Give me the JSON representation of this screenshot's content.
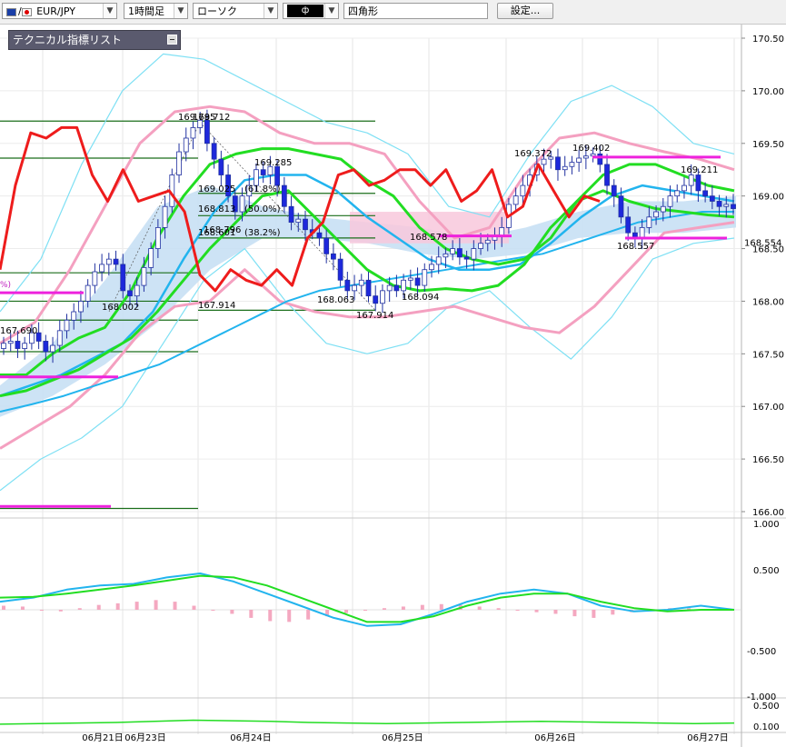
{
  "toolbar": {
    "symbol": "EUR/JPY",
    "timeframe": "1時間足",
    "chart_style": "ローソク",
    "draw_mode": "ф",
    "shape": "四角形",
    "settings_label": "設定..."
  },
  "indicator_panel": {
    "title": "テクニカル指標リスト"
  },
  "colors": {
    "up_candle": "#ffffff",
    "down_candle": "#1e28dc",
    "rsi_line": "#ee1c1c",
    "ma_green": "#22dd22",
    "ma_blue": "#22b4ee",
    "bollinger_pink": "#f4a0c0",
    "bollinger_outer": "#7ee0f4",
    "cloud": "#c8e0f4",
    "fib_line": "#1a6e1a",
    "magenta_line": "#ee22dd"
  },
  "chart_data": [
    {
      "type": "candlestick",
      "title": "",
      "yaxis_ticks": [
        "170.50",
        "170.00",
        "169.50",
        "169.00",
        "168.50",
        "168.00",
        "167.50",
        "167.00",
        "166.50",
        "166.00"
      ],
      "ylim": [
        165.95,
        170.55
      ],
      "current_price_label": "168.554",
      "xaxis_ticks": [
        "06月21日",
        "06月23日",
        "06月24日",
        "06月25日",
        "06月26日",
        "06月27日"
      ],
      "price_labels": [
        "167.690",
        "168.002",
        "169.712",
        "169.785",
        "169.285",
        "168.796",
        "168.063",
        "167.914",
        "167.914",
        "168.094",
        "168.578",
        "169.372",
        "169.402",
        "169.211",
        "168.557"
      ],
      "fib_labels": [
        "169.025",
        "(61.8%)",
        "168.813",
        "(50.0%)",
        "168.601",
        "(38.2%)"
      ],
      "partial_label": "%)",
      "close": [
        167.6,
        167.62,
        167.55,
        167.6,
        167.7,
        167.62,
        167.52,
        167.58,
        167.72,
        167.82,
        167.9,
        168.0,
        168.15,
        168.28,
        168.35,
        168.4,
        168.35,
        168.1,
        168.05,
        168.15,
        168.32,
        168.5,
        168.7,
        168.9,
        169.2,
        169.42,
        169.55,
        169.65,
        169.72,
        169.5,
        169.35,
        169.2,
        169.0,
        168.85,
        169.0,
        169.1,
        169.25,
        169.2,
        169.28,
        169.1,
        168.9,
        168.75,
        168.78,
        168.68,
        168.65,
        168.6,
        168.45,
        168.4,
        168.2,
        168.1,
        168.15,
        168.2,
        168.05,
        167.98,
        168.1,
        168.15,
        168.1,
        168.2,
        168.22,
        168.15,
        168.3,
        168.35,
        168.42,
        168.45,
        168.5,
        168.42,
        168.4,
        168.5,
        168.55,
        168.58,
        168.62,
        168.7,
        168.92,
        169.0,
        169.1,
        169.2,
        169.3,
        169.35,
        169.37,
        169.25,
        169.28,
        169.32,
        169.36,
        169.38,
        169.4,
        169.3,
        169.1,
        169.0,
        168.8,
        168.65,
        168.6,
        168.7,
        168.8,
        168.85,
        168.9,
        169.0,
        169.05,
        169.1,
        169.2,
        169.05,
        169.0,
        168.95,
        168.9,
        168.92,
        168.88
      ],
      "fib_levels": [
        167.914,
        168.27,
        168.601,
        168.813,
        169.025,
        169.36,
        169.712
      ],
      "rsi_line": [
        168.3,
        169.1,
        169.6,
        169.55,
        169.65,
        169.65,
        169.2,
        168.95,
        169.25,
        168.95,
        169.0,
        169.05,
        168.85,
        168.25,
        168.1,
        168.3,
        168.2,
        168.15,
        168.3,
        168.15,
        168.6,
        168.75,
        169.2,
        169.25,
        169.1,
        169.15,
        169.25,
        169.25,
        169.1,
        169.25,
        168.95,
        169.05,
        169.25,
        168.8,
        168.9,
        169.3,
        169.05,
        168.8,
        169.0,
        168.95
      ],
      "ma_green_1": [
        167.3,
        167.3,
        167.5,
        167.65,
        167.75,
        168.1,
        168.6,
        169.0,
        169.3,
        169.4,
        169.45,
        169.45,
        169.4,
        169.35,
        169.15,
        169.0,
        168.7,
        168.5,
        168.4,
        168.35,
        168.4,
        168.6,
        168.95,
        169.2,
        169.3,
        169.3,
        169.2,
        169.1,
        169.05
      ],
      "ma_green_2": [
        167.1,
        167.15,
        167.25,
        167.35,
        167.5,
        167.65,
        167.9,
        168.2,
        168.5,
        168.75,
        169.0,
        169.05,
        168.8,
        168.55,
        168.3,
        168.15,
        168.1,
        168.12,
        168.1,
        168.15,
        168.35,
        168.7,
        168.95,
        169.05,
        168.95,
        168.88,
        168.85,
        168.82,
        168.8
      ],
      "ma_blue_1": [
        167.1,
        167.2,
        167.3,
        167.45,
        167.6,
        167.9,
        168.4,
        168.85,
        169.15,
        169.2,
        169.2,
        169.05,
        168.8,
        168.6,
        168.4,
        168.3,
        168.3,
        168.35,
        168.55,
        168.8,
        169.0,
        169.1,
        169.05,
        169.0,
        168.95
      ],
      "ma_blue_2": [
        166.95,
        167.02,
        167.1,
        167.2,
        167.3,
        167.4,
        167.55,
        167.7,
        167.85,
        168.0,
        168.1,
        168.15,
        168.2,
        168.25,
        168.3,
        168.35,
        168.4,
        168.45,
        168.55,
        168.65,
        168.75,
        168.8,
        168.85,
        168.85
      ],
      "bb_pink_upper": [
        167.6,
        167.8,
        168.3,
        168.9,
        169.5,
        169.8,
        169.85,
        169.8,
        169.6,
        169.5,
        169.5,
        169.4,
        168.95,
        168.6,
        168.7,
        169.2,
        169.55,
        169.6,
        169.5,
        169.42,
        169.35,
        169.25
      ],
      "bb_pink_lower": [
        166.6,
        166.8,
        167.0,
        167.3,
        167.7,
        167.95,
        168.0,
        168.3,
        168.0,
        167.9,
        167.85,
        167.85,
        167.9,
        167.95,
        167.85,
        167.75,
        167.7,
        167.95,
        168.3,
        168.65,
        168.7,
        168.75
      ],
      "bb_cyan_upper": [
        167.9,
        168.4,
        169.3,
        170.0,
        170.35,
        170.3,
        170.1,
        169.9,
        169.7,
        169.6,
        169.4,
        168.9,
        168.8,
        169.4,
        169.9,
        170.05,
        169.85,
        169.5,
        169.4
      ],
      "bb_cyan_lower": [
        166.2,
        166.5,
        166.7,
        167.0,
        167.6,
        168.2,
        168.5,
        168.0,
        167.6,
        167.5,
        167.6,
        167.95,
        168.1,
        167.75,
        167.45,
        167.85,
        168.4,
        168.55,
        168.6
      ],
      "cloud_top": [
        167.2,
        167.6,
        168.2,
        168.9,
        169.1,
        168.9,
        168.8,
        168.75,
        168.7,
        168.6,
        168.7,
        168.85,
        168.95,
        168.95,
        169.0
      ],
      "cloud_bottom": [
        166.9,
        167.1,
        167.4,
        167.8,
        168.3,
        168.6,
        168.6,
        168.55,
        168.45,
        168.4,
        168.45,
        168.6,
        168.65,
        168.65,
        168.7
      ],
      "pink_box": [
        168.55,
        168.85
      ]
    },
    {
      "type": "line",
      "title": "",
      "yaxis_ticks": [
        "1.000",
        "0.500",
        "-0.500",
        "-1.000"
      ],
      "ylim": [
        -1.05,
        1.05
      ],
      "line_cyan": [
        0.1,
        0.15,
        0.25,
        0.3,
        0.32,
        0.4,
        0.45,
        0.35,
        0.2,
        0.05,
        -0.1,
        -0.2,
        -0.18,
        -0.05,
        0.1,
        0.2,
        0.25,
        0.2,
        0.05,
        -0.02,
        0.0,
        0.05,
        0.0
      ],
      "line_green": [
        0.15,
        0.16,
        0.2,
        0.25,
        0.3,
        0.36,
        0.42,
        0.4,
        0.3,
        0.15,
        0.0,
        -0.15,
        -0.15,
        -0.08,
        0.05,
        0.15,
        0.2,
        0.2,
        0.1,
        0.02,
        -0.02,
        0.0,
        0.0
      ],
      "histogram": [
        0.05,
        0.04,
        0.0,
        -0.02,
        0.02,
        0.06,
        0.08,
        0.1,
        0.12,
        0.1,
        0.05,
        0.0,
        -0.05,
        -0.1,
        -0.14,
        -0.15,
        -0.12,
        -0.08,
        -0.04,
        0.0,
        0.02,
        0.04,
        0.06,
        0.07,
        0.06,
        0.04,
        0.02,
        0.0,
        -0.03,
        -0.05,
        -0.08,
        -0.1,
        -0.06,
        -0.03,
        0.0,
        0.02,
        0.02,
        0.01,
        0.0
      ]
    },
    {
      "type": "line",
      "title": "",
      "yaxis_ticks": [
        "0.500",
        "0.100"
      ],
      "ylim": [
        0.0,
        0.6
      ],
      "line_green": [
        0.15,
        0.16,
        0.17,
        0.18,
        0.2,
        0.22,
        0.21,
        0.2,
        0.18,
        0.17,
        0.16,
        0.17,
        0.18,
        0.19,
        0.2,
        0.19,
        0.18,
        0.17,
        0.16,
        0.17
      ]
    }
  ]
}
